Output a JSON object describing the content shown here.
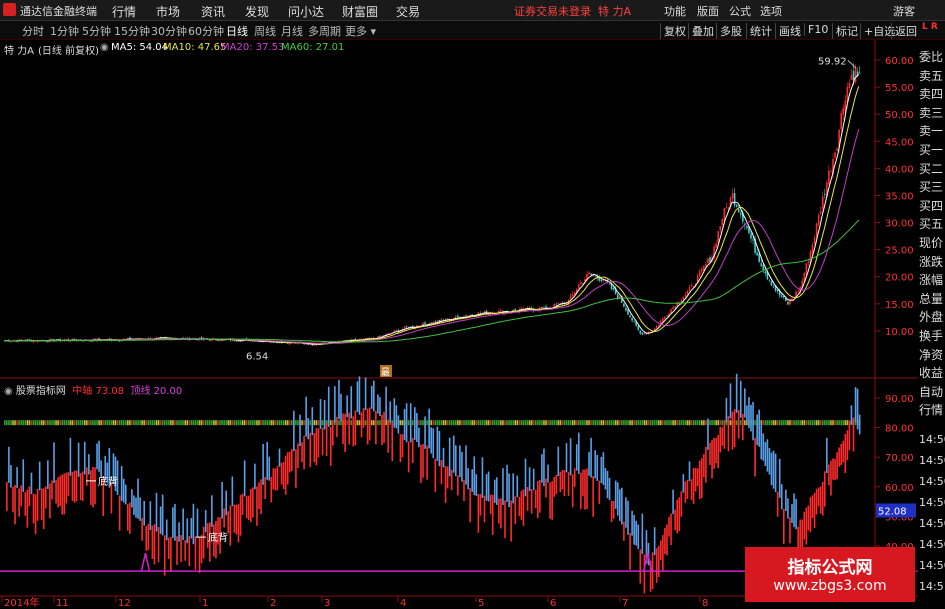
{
  "app": {
    "name": "通达信金融终端",
    "notice": "证券交易未登录",
    "stock_title": "特 力A"
  },
  "top_menu": [
    "行情",
    "市场",
    "资讯",
    "发现",
    "问小达",
    "财富圈",
    "交易"
  ],
  "top_right": [
    "功能",
    "版面",
    "公式",
    "选项",
    "游客"
  ],
  "period_tabs": [
    "分时",
    "1分钟",
    "5分钟",
    "15分钟",
    "30分钟",
    "60分钟",
    "日线",
    "周线",
    "月线",
    "多周期",
    "更多"
  ],
  "active_tab": "日线",
  "toolbar": [
    "复权",
    "叠加",
    "多股",
    "统计",
    "画线",
    "F10",
    "标记",
    "+自选",
    "返回"
  ],
  "main_info": {
    "stock": "特 力A",
    "mode": "(日线 前复权)",
    "ma5": "MA5: 54.04",
    "ma10": "MA10: 47.65",
    "ma20": "MA20: 37.53",
    "ma60": "MA60: 27.01"
  },
  "indicator_info": {
    "name": "股票指标网",
    "mid_label": "中轴",
    "mid_value": "73.08",
    "top_label": "顶线",
    "top_value": "20.00"
  },
  "annotations": {
    "max_price": "59.92",
    "min_price": "6.54",
    "flag": "最",
    "bottom1": "底背",
    "bottom2": "底背",
    "current_ind": "52.08"
  },
  "price_axis": [
    "60.00",
    "55.00",
    "50.00",
    "45.00",
    "40.00",
    "35.00",
    "30.00",
    "25.00",
    "20.00",
    "15.00",
    "10.00"
  ],
  "ind_axis": [
    "90.00",
    "80.00",
    "70.00",
    "60.00",
    "50.00",
    "40.00"
  ],
  "date_axis": [
    "2014年",
    "11",
    "12",
    "1",
    "2",
    "3",
    "4",
    "5",
    "6",
    "7",
    "8"
  ],
  "sidebar_items": [
    "委比",
    "卖五",
    "卖四",
    "卖三",
    "卖一",
    "买一",
    "买二",
    "买三",
    "买四",
    "买五",
    "现价",
    "涨跌",
    "涨幅",
    "总量",
    "外盘",
    "换手",
    "净资",
    "收益",
    "自动",
    "行情"
  ],
  "sidebar_times": [
    "14:50",
    "14:50",
    "14:50",
    "14:50",
    "14:50",
    "14:50",
    "14:50",
    "14:51"
  ],
  "watermark": {
    "line1": "指标公式网",
    "line2": "www.zbgs3.com"
  },
  "colors": {
    "up": "#ff2a2a",
    "down": "#5aa0e8",
    "ma5": "#ffffff",
    "ma10": "#e8e83a",
    "ma20": "#c040c0",
    "ma60": "#40c040",
    "accent": "#d42020"
  }
}
